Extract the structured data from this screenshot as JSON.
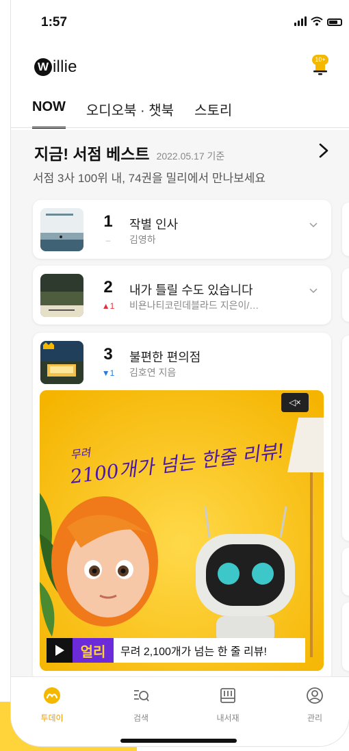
{
  "status_bar": {
    "time": "1:57"
  },
  "header": {
    "logo_mark": "W",
    "logo_text": "illie",
    "notification_badge": "10+"
  },
  "tabs": [
    {
      "label": "NOW",
      "active": true
    },
    {
      "label": "오디오북 · 챗북",
      "active": false
    },
    {
      "label": "스토리",
      "active": false
    }
  ],
  "section": {
    "title": "지금! 서점 베스트",
    "date": "2022.05.17 기준",
    "subtitle": "서점 3사 100위 내, 74권을 밀리에서 만나보세요"
  },
  "books": [
    {
      "rank": "1",
      "change": "–",
      "change_dir": "same",
      "title": "작별 인사",
      "author": "김영하"
    },
    {
      "rank": "2",
      "change": "▲1",
      "change_dir": "up",
      "title": "내가 틀릴 수도 있습니다",
      "author": "비욘나티코린데블라드 지은이/…"
    },
    {
      "rank": "3",
      "change": "▼1",
      "change_dir": "down",
      "title": "불편한 편의점",
      "author": "김호연 지음"
    }
  ],
  "banner": {
    "headline_small": "무려",
    "headline": "2100개가 넘는 한줄 리뷰!",
    "brand": "얼리",
    "caption": "무려 2,100개가 넘는 한 줄 리뷰!",
    "mute_label": "◁×"
  },
  "bottom_nav": [
    {
      "label": "투데이",
      "icon": "today-icon",
      "active": true
    },
    {
      "label": "검색",
      "icon": "search-icon",
      "active": false
    },
    {
      "label": "내서재",
      "icon": "library-icon",
      "active": false
    },
    {
      "label": "관리",
      "icon": "profile-icon",
      "active": false
    }
  ],
  "colors": {
    "accent": "#f5b800",
    "brand_purple": "#6c2bd9",
    "up": "#e0303a",
    "down": "#2a7bd8"
  }
}
